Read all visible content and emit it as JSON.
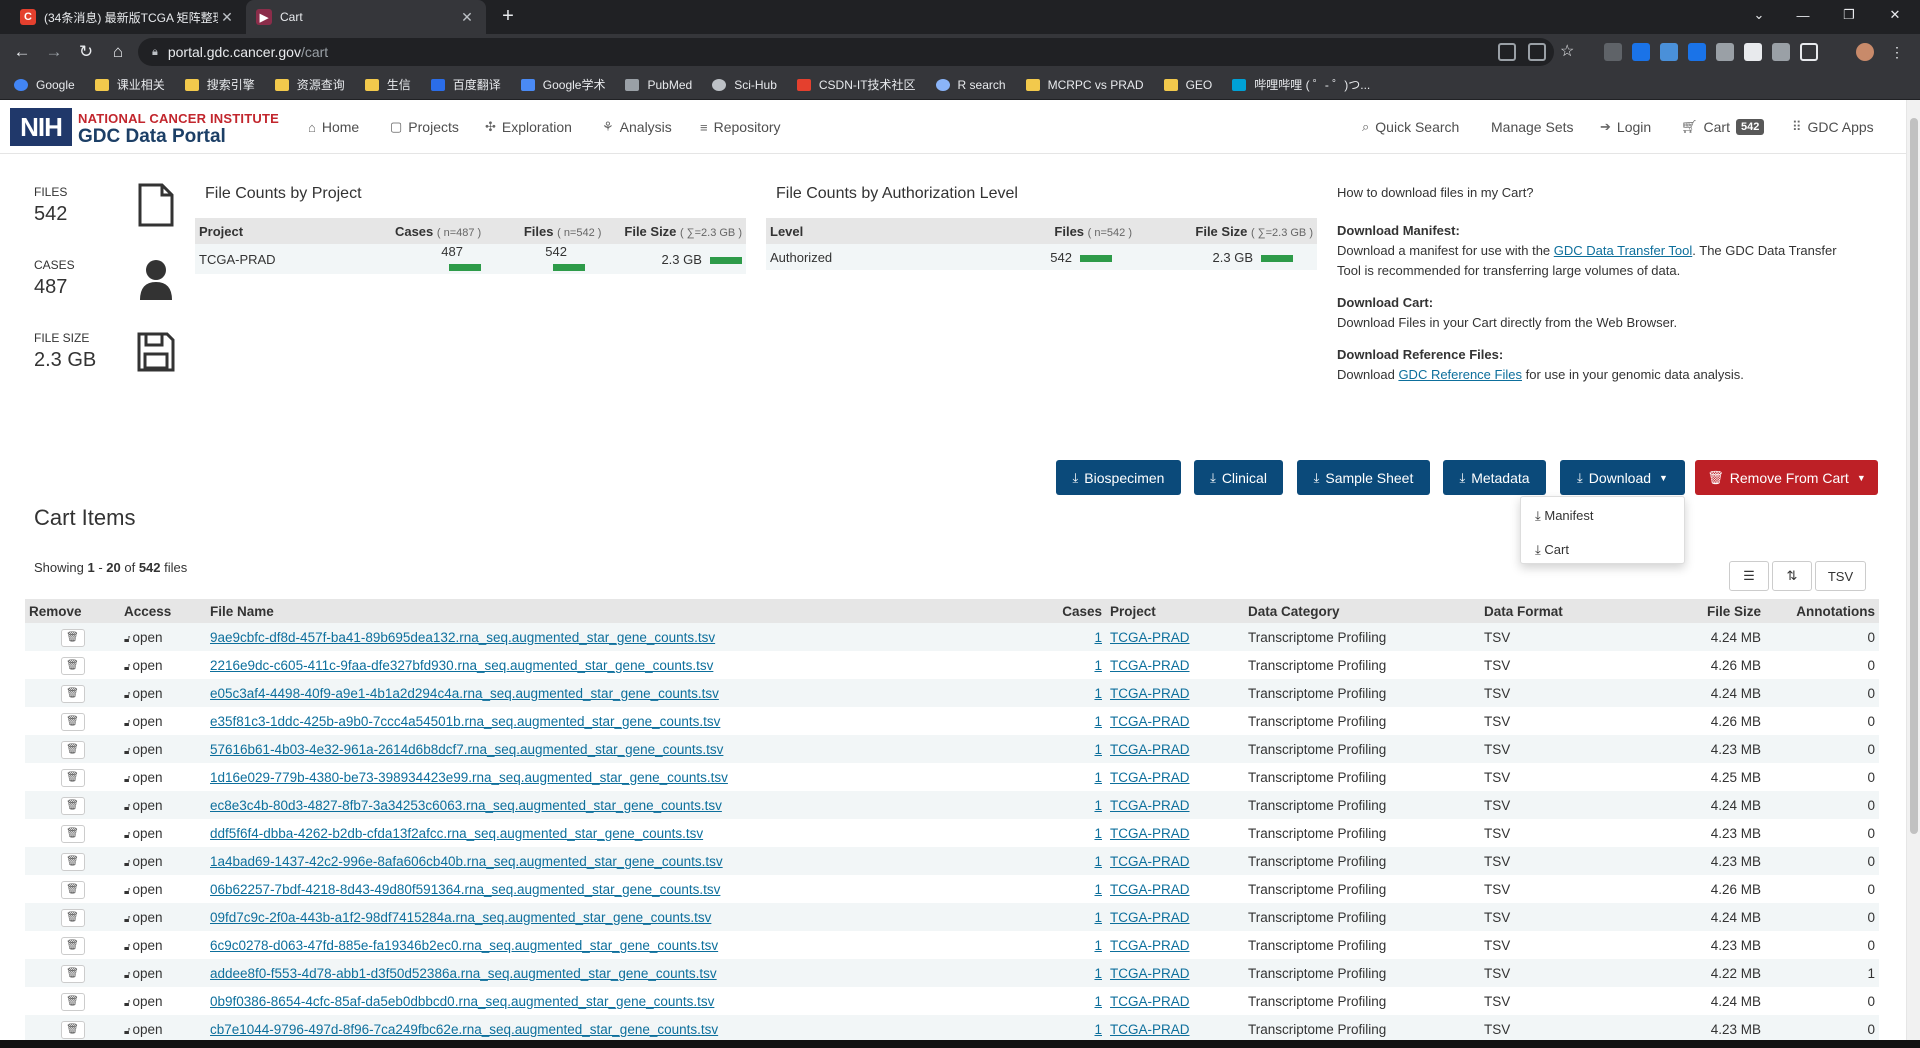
{
  "browser": {
    "tabs": [
      {
        "title": "(34条消息) 最新版TCGA 矩阵整理",
        "active": false
      },
      {
        "title": "Cart",
        "active": true
      }
    ],
    "url_host": "portal.gdc.cancer.gov",
    "url_path": "/cart",
    "bookmarks": [
      "Google",
      "课业相关",
      "搜索引擎",
      "资源查询",
      "生信",
      "百度翻译",
      "Google学术",
      "PubMed",
      "Sci-Hub",
      "CSDN-IT技术社区",
      "R search",
      "MCRPC vs PRAD",
      "GEO",
      "哔哩哔哩 ( ゜- ゜)つ..."
    ]
  },
  "header": {
    "logo": "NIH",
    "brand_line1": "NATIONAL CANCER INSTITUTE",
    "brand_line2": "GDC Data Portal",
    "nav": [
      "Home",
      "Projects",
      "Exploration",
      "Analysis",
      "Repository"
    ],
    "quick_search": "Quick Search",
    "manage_sets": "Manage Sets",
    "login": "Login",
    "cart": "Cart",
    "cart_count": "542",
    "gdc_apps": "GDC Apps"
  },
  "summary": {
    "files_label": "FILES",
    "files_value": "542",
    "cases_label": "CASES",
    "cases_value": "487",
    "size_label": "FILE SIZE",
    "size_value": "2.3 GB"
  },
  "by_project": {
    "title": "File Counts by Project",
    "h_project": "Project",
    "h_cases": "Cases",
    "h_cases_sub": "( n=487 )",
    "h_files": "Files",
    "h_files_sub": "( n=542 )",
    "h_size": "File Size",
    "h_size_sub": "( ∑=2.3 GB )",
    "row": {
      "project": "TCGA-PRAD",
      "cases": "487",
      "files": "542",
      "size": "2.3 GB"
    }
  },
  "by_auth": {
    "title": "File Counts by Authorization Level",
    "h_level": "Level",
    "h_files": "Files",
    "h_files_sub": "( n=542 )",
    "h_size": "File Size",
    "h_size_sub": "( ∑=2.3 GB )",
    "row": {
      "level": "Authorized",
      "files": "542",
      "size": "2.3 GB"
    }
  },
  "help": {
    "question": "How to download files in my Cart?",
    "manifest_h": "Download Manifest:",
    "manifest_t1": "Download a manifest for use with the ",
    "manifest_link": "GDC Data Transfer Tool",
    "manifest_t2": ". The GDC Data Transfer Tool is recommended for transferring large volumes of data.",
    "cart_h": "Download Cart:",
    "cart_t": "Download Files in your Cart directly from the Web Browser.",
    "ref_h": "Download Reference Files:",
    "ref_t1": "Download ",
    "ref_link": "GDC Reference Files",
    "ref_t2": " for use in your genomic data analysis."
  },
  "actions": {
    "biospecimen": "Biospecimen",
    "clinical": "Clinical",
    "sample_sheet": "Sample Sheet",
    "metadata": "Metadata",
    "download": "Download",
    "remove": "Remove From Cart",
    "menu": [
      "Manifest",
      "Cart"
    ]
  },
  "cart": {
    "title": "Cart Items",
    "showing_prefix": "Showing ",
    "from": "1",
    "dash": " - ",
    "to": "20",
    "of": " of ",
    "total": "542",
    "suffix": " files",
    "tsv": "TSV",
    "columns": [
      "Remove",
      "Access",
      "File Name",
      "Cases",
      "Project",
      "Data Category",
      "Data Format",
      "File Size",
      "Annotations"
    ],
    "rows": [
      {
        "access": "open",
        "file": "9ae9cbfc-df8d-457f-ba41-89b695dea132.rna_seq.augmented_star_gene_counts.tsv",
        "cases": "1",
        "project": "TCGA-PRAD",
        "category": "Transcriptome Profiling",
        "format": "TSV",
        "size": "4.24 MB",
        "annotations": "0"
      },
      {
        "access": "open",
        "file": "2216e9dc-c605-411c-9faa-dfe327bfd930.rna_seq.augmented_star_gene_counts.tsv",
        "cases": "1",
        "project": "TCGA-PRAD",
        "category": "Transcriptome Profiling",
        "format": "TSV",
        "size": "4.26 MB",
        "annotations": "0"
      },
      {
        "access": "open",
        "file": "e05c3af4-4498-40f9-a9e1-4b1a2d294c4a.rna_seq.augmented_star_gene_counts.tsv",
        "cases": "1",
        "project": "TCGA-PRAD",
        "category": "Transcriptome Profiling",
        "format": "TSV",
        "size": "4.24 MB",
        "annotations": "0"
      },
      {
        "access": "open",
        "file": "e35f81c3-1ddc-425b-a9b0-7ccc4a54501b.rna_seq.augmented_star_gene_counts.tsv",
        "cases": "1",
        "project": "TCGA-PRAD",
        "category": "Transcriptome Profiling",
        "format": "TSV",
        "size": "4.26 MB",
        "annotations": "0"
      },
      {
        "access": "open",
        "file": "57616b61-4b03-4e32-961a-2614d6b8dcf7.rna_seq.augmented_star_gene_counts.tsv",
        "cases": "1",
        "project": "TCGA-PRAD",
        "category": "Transcriptome Profiling",
        "format": "TSV",
        "size": "4.23 MB",
        "annotations": "0"
      },
      {
        "access": "open",
        "file": "1d16e029-779b-4380-be73-398934423e99.rna_seq.augmented_star_gene_counts.tsv",
        "cases": "1",
        "project": "TCGA-PRAD",
        "category": "Transcriptome Profiling",
        "format": "TSV",
        "size": "4.25 MB",
        "annotations": "0"
      },
      {
        "access": "open",
        "file": "ec8e3c4b-80d3-4827-8fb7-3a34253c6063.rna_seq.augmented_star_gene_counts.tsv",
        "cases": "1",
        "project": "TCGA-PRAD",
        "category": "Transcriptome Profiling",
        "format": "TSV",
        "size": "4.24 MB",
        "annotations": "0"
      },
      {
        "access": "open",
        "file": "ddf5f6f4-dbba-4262-b2db-cfda13f2afcc.rna_seq.augmented_star_gene_counts.tsv",
        "cases": "1",
        "project": "TCGA-PRAD",
        "category": "Transcriptome Profiling",
        "format": "TSV",
        "size": "4.23 MB",
        "annotations": "0"
      },
      {
        "access": "open",
        "file": "1a4bad69-1437-42c2-996e-8afa606cb40b.rna_seq.augmented_star_gene_counts.tsv",
        "cases": "1",
        "project": "TCGA-PRAD",
        "category": "Transcriptome Profiling",
        "format": "TSV",
        "size": "4.23 MB",
        "annotations": "0"
      },
      {
        "access": "open",
        "file": "06b62257-7bdf-4218-8d43-49d80f591364.rna_seq.augmented_star_gene_counts.tsv",
        "cases": "1",
        "project": "TCGA-PRAD",
        "category": "Transcriptome Profiling",
        "format": "TSV",
        "size": "4.26 MB",
        "annotations": "0"
      },
      {
        "access": "open",
        "file": "09fd7c9c-2f0a-443b-a1f2-98df7415284a.rna_seq.augmented_star_gene_counts.tsv",
        "cases": "1",
        "project": "TCGA-PRAD",
        "category": "Transcriptome Profiling",
        "format": "TSV",
        "size": "4.24 MB",
        "annotations": "0"
      },
      {
        "access": "open",
        "file": "6c9c0278-d063-47fd-885e-fa19346b2ec0.rna_seq.augmented_star_gene_counts.tsv",
        "cases": "1",
        "project": "TCGA-PRAD",
        "category": "Transcriptome Profiling",
        "format": "TSV",
        "size": "4.23 MB",
        "annotations": "0"
      },
      {
        "access": "open",
        "file": "addee8f0-f553-4d78-abb1-d3f50d52386a.rna_seq.augmented_star_gene_counts.tsv",
        "cases": "1",
        "project": "TCGA-PRAD",
        "category": "Transcriptome Profiling",
        "format": "TSV",
        "size": "4.22 MB",
        "annotations": "1"
      },
      {
        "access": "open",
        "file": "0b9f0386-8654-4cfc-85af-da5eb0dbbcd0.rna_seq.augmented_star_gene_counts.tsv",
        "cases": "1",
        "project": "TCGA-PRAD",
        "category": "Transcriptome Profiling",
        "format": "TSV",
        "size": "4.24 MB",
        "annotations": "0"
      },
      {
        "access": "open",
        "file": "cb7e1044-9796-497d-8f96-7ca249fbc62e.rna_seq.augmented_star_gene_counts.tsv",
        "cases": "1",
        "project": "TCGA-PRAD",
        "category": "Transcriptome Profiling",
        "format": "TSV",
        "size": "4.23 MB",
        "annotations": "0"
      }
    ]
  },
  "colors": {
    "gdc_blue": "#0b4a7a",
    "remove_red": "#bd2026",
    "bar_green": "#2e9b49",
    "link": "#0d6f9c"
  }
}
